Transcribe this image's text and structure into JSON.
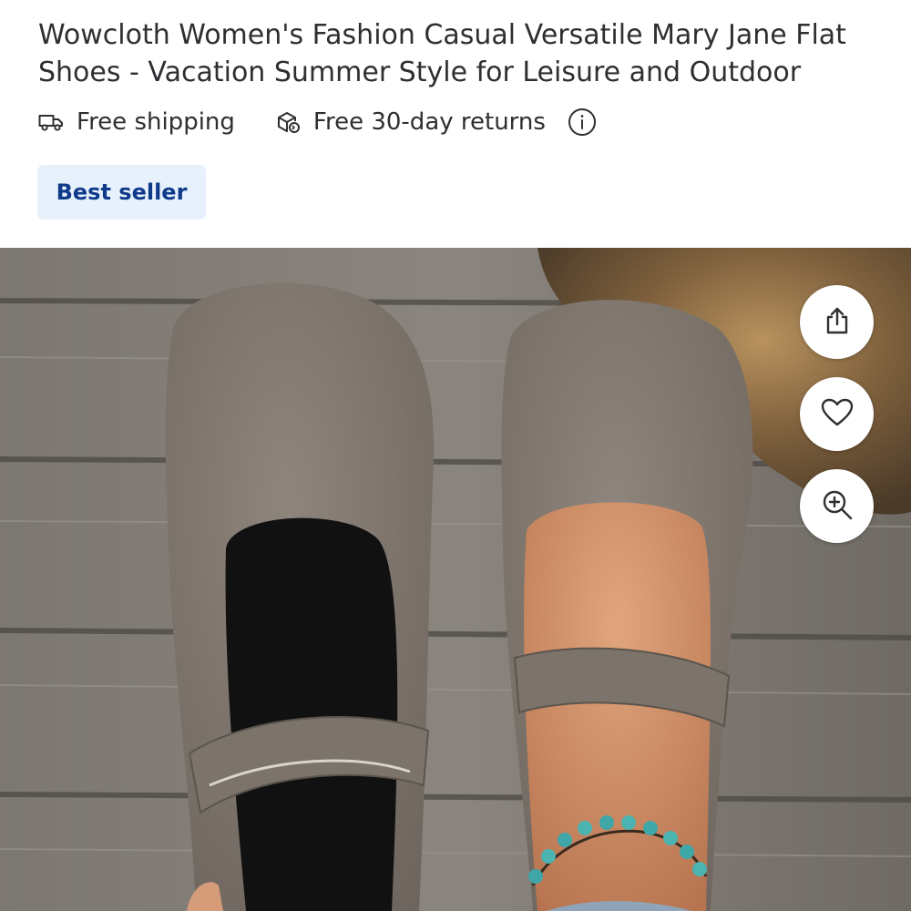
{
  "product": {
    "title": "Wowcloth Women's Fashion Casual Versatile Mary Jane Flat Shoes - Vacation Summer Style for Leisure and Outdoor",
    "badge": "Best seller"
  },
  "fulfillment": {
    "shipping_label": "Free shipping",
    "shipping_icon": "truck-icon",
    "returns_label": "Free 30-day returns",
    "returns_icon": "returns-box-icon",
    "info_icon": "info-icon"
  },
  "image_actions": {
    "share_icon": "share-icon",
    "favorite_icon": "heart-icon",
    "zoom_icon": "zoom-in-icon"
  },
  "colors": {
    "badge_background": "#e6f1fc",
    "badge_text": "#0f3a8a",
    "text": "#2e2f32"
  }
}
